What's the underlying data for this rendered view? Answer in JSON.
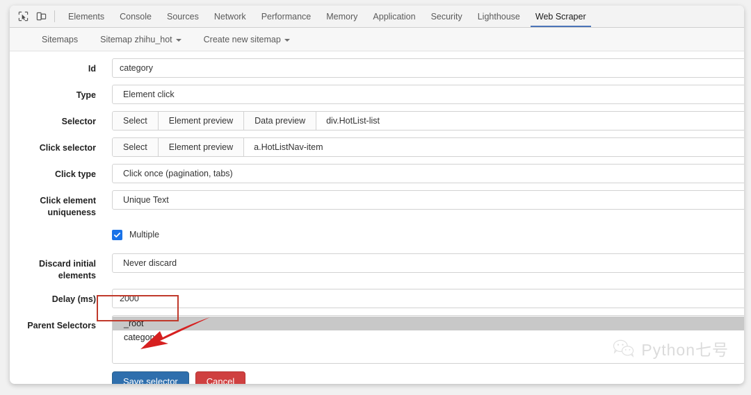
{
  "devtools": {
    "icons": [
      {
        "name": "inspect-element-icon"
      },
      {
        "name": "device-toolbar-icon"
      }
    ],
    "tabs": [
      {
        "label": "Elements",
        "active": false
      },
      {
        "label": "Console",
        "active": false
      },
      {
        "label": "Sources",
        "active": false
      },
      {
        "label": "Network",
        "active": false
      },
      {
        "label": "Performance",
        "active": false
      },
      {
        "label": "Memory",
        "active": false
      },
      {
        "label": "Application",
        "active": false
      },
      {
        "label": "Security",
        "active": false
      },
      {
        "label": "Lighthouse",
        "active": false
      },
      {
        "label": "Web Scraper",
        "active": true
      }
    ],
    "active_tab_underline_color": "#4a74b8"
  },
  "webscraper_nav": [
    {
      "label": "Sitemaps",
      "caret": false
    },
    {
      "label": "Sitemap zhihu_hot",
      "caret": true
    },
    {
      "label": "Create new sitemap",
      "caret": true
    }
  ],
  "form": {
    "id": {
      "label": "Id",
      "value": "category"
    },
    "type": {
      "label": "Type",
      "value": "Element click"
    },
    "selector": {
      "label": "Selector",
      "buttons": [
        "Select",
        "Element preview",
        "Data preview"
      ],
      "value": "div.HotList-list"
    },
    "click_selector": {
      "label": "Click selector",
      "buttons": [
        "Select",
        "Element preview"
      ],
      "value": "a.HotListNav-item"
    },
    "click_type": {
      "label": "Click type",
      "value": "Click once (pagination, tabs)"
    },
    "click_element_uniqueness": {
      "label": "Click element uniqueness",
      "value": "Unique Text"
    },
    "multiple": {
      "label": "Multiple",
      "checked": true,
      "color": "#1a73e8"
    },
    "discard_initial_elements": {
      "label": "Discard initial elements",
      "value": "Never discard"
    },
    "delay": {
      "label": "Delay (ms)",
      "value": "2000"
    },
    "parent_selectors": {
      "label": "Parent Selectors",
      "options": [
        {
          "label": "_root",
          "selected": true
        },
        {
          "label": "category",
          "selected": false
        }
      ]
    },
    "buttons": {
      "save": {
        "label": "Save selector",
        "color": "#2f6fad"
      },
      "cancel": {
        "label": "Cancel",
        "color": "#cf4040"
      }
    }
  },
  "annotations": {
    "highlight_rect_color": "#c0392b",
    "arrow_color": "#d62020"
  },
  "watermark": {
    "text": "Python七号",
    "icon": "wechat-icon"
  }
}
